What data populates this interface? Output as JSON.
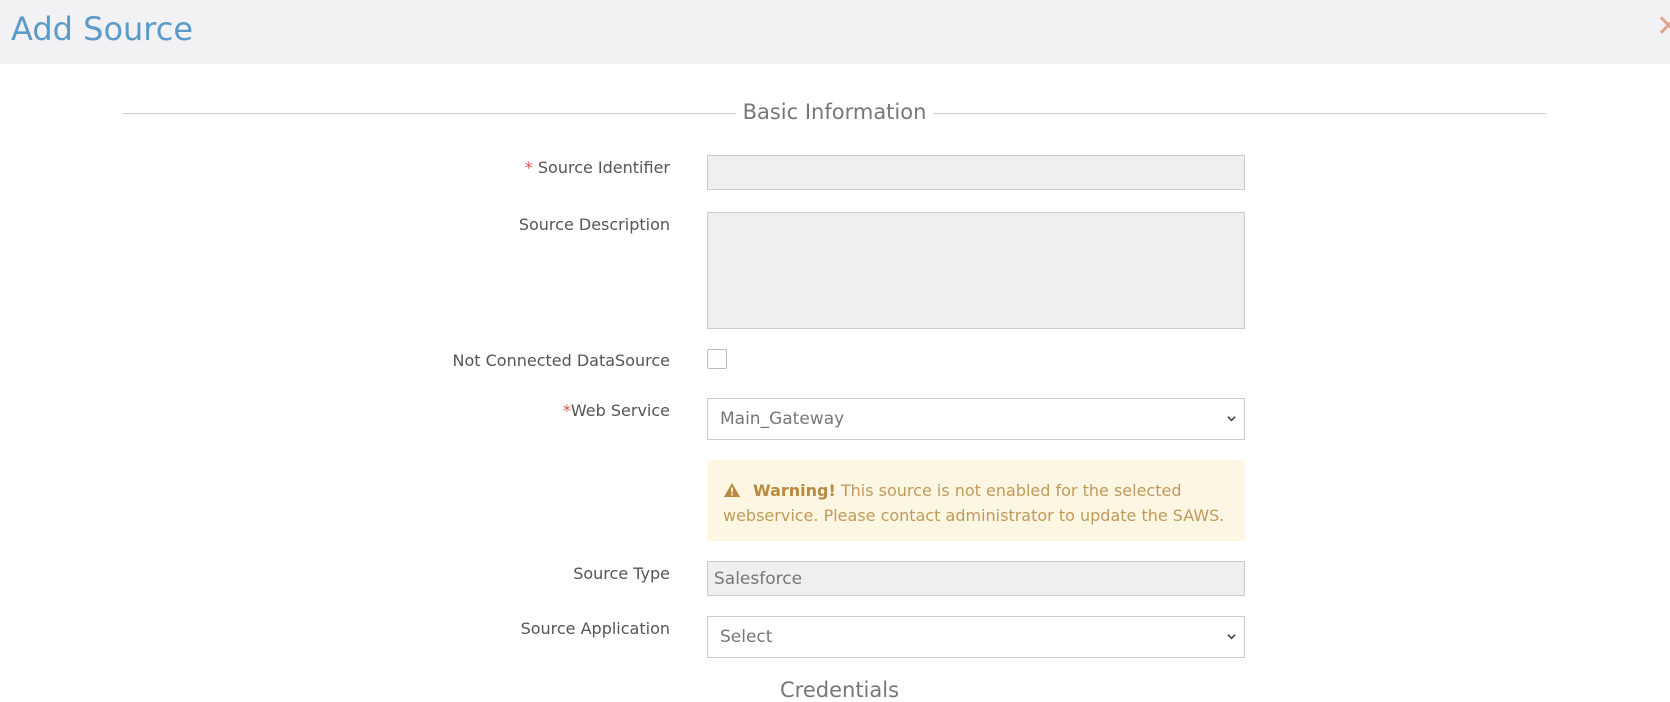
{
  "header": {
    "title": "Add Source",
    "close_icon": "close-icon"
  },
  "section_basic": {
    "legend": "Basic Information"
  },
  "form": {
    "source_identifier": {
      "required_mark": "*",
      "label": "Source Identifier",
      "value": ""
    },
    "source_description": {
      "label": "Source Description",
      "value": ""
    },
    "not_connected": {
      "label": "Not Connected DataSource",
      "checked": false
    },
    "web_service": {
      "required_mark": "*",
      "label": "Web Service",
      "value": "Main_Gateway"
    },
    "warning": {
      "title": "Warning!",
      "message": "This source is not enabled for the selected webservice. Please contact administrator to update the SAWS.",
      "icon": "warning-triangle-icon"
    },
    "source_type": {
      "label": "Source Type",
      "value": "Salesforce"
    },
    "source_application": {
      "label": "Source Application",
      "value": "Select"
    }
  },
  "section_credentials": {
    "legend": "Credentials"
  },
  "colors": {
    "title": "#5b9bc9",
    "required": "#d9534f",
    "warning_bg": "#fcf6e3",
    "warning_text": "#c19a5a"
  }
}
